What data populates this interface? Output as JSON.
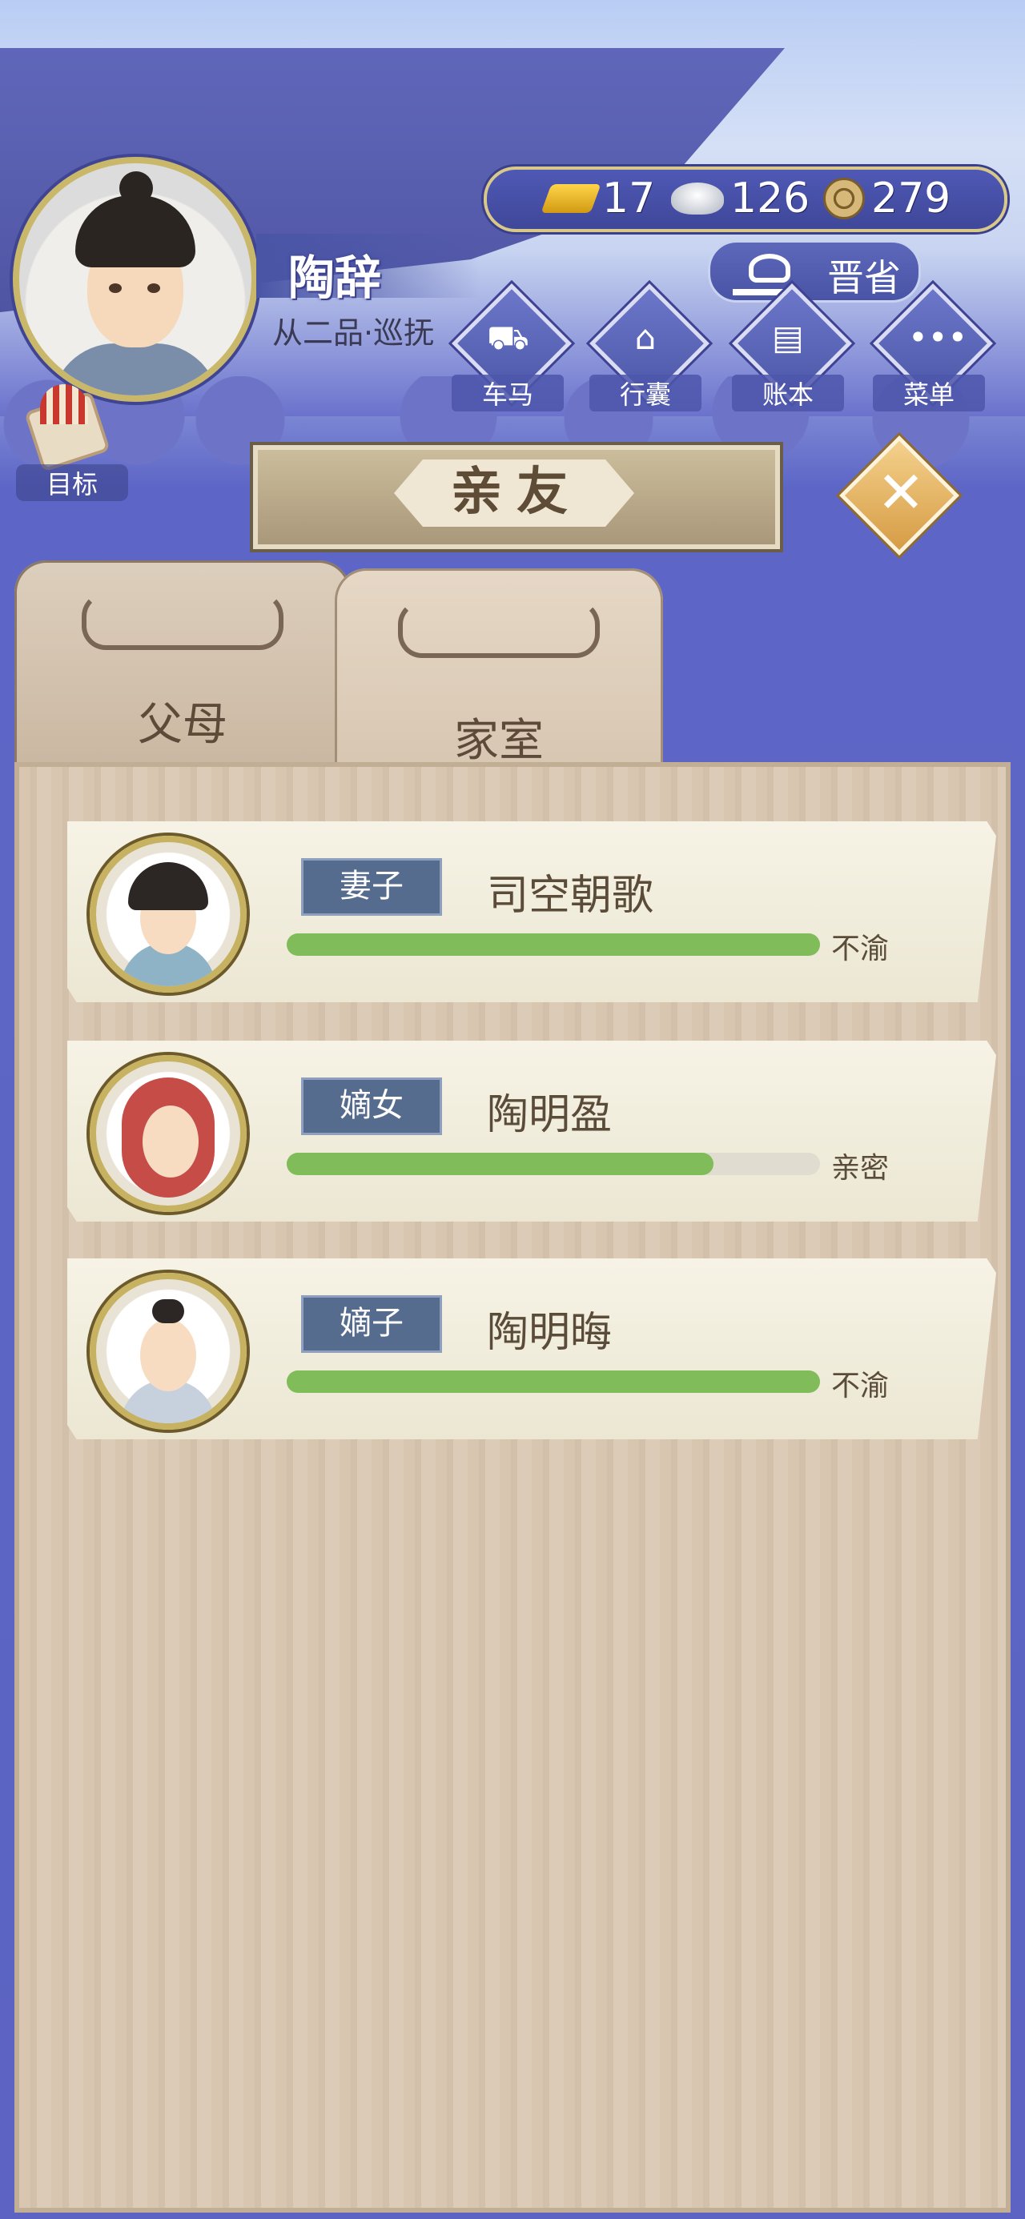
{
  "player": {
    "name": "陶辞",
    "rank": "从二品·巡抚"
  },
  "currency": {
    "gold": "17",
    "silver": "126",
    "coins": "279"
  },
  "actions": {
    "promote": "晋省",
    "goal": "目标",
    "menu": [
      {
        "label": "车马",
        "icon": "carriage-icon",
        "glyph": "⛟"
      },
      {
        "label": "行囊",
        "icon": "bag-icon",
        "glyph": "⌂"
      },
      {
        "label": "账本",
        "icon": "ledger-icon",
        "glyph": "▤"
      },
      {
        "label": "菜单",
        "icon": "menu-dots-icon",
        "glyph": "•••"
      }
    ]
  },
  "page": {
    "title": "亲友",
    "close_icon": "close-icon",
    "tabs": [
      {
        "label": "父母",
        "active": false
      },
      {
        "label": "家室",
        "active": true
      }
    ]
  },
  "family": [
    {
      "role": "妻子",
      "name": "司空朝歌",
      "status": "不渝",
      "affinity": 1.0
    },
    {
      "role": "嫡女",
      "name": "陶明盈",
      "status": "亲密",
      "affinity": 0.8
    },
    {
      "role": "嫡子",
      "name": "陶明晦",
      "status": "不渝",
      "affinity": 1.0
    }
  ],
  "colors": {
    "accent_blue": "#4f59b5",
    "bar_green": "#80bd5a",
    "gold_border": "#c6b261"
  }
}
